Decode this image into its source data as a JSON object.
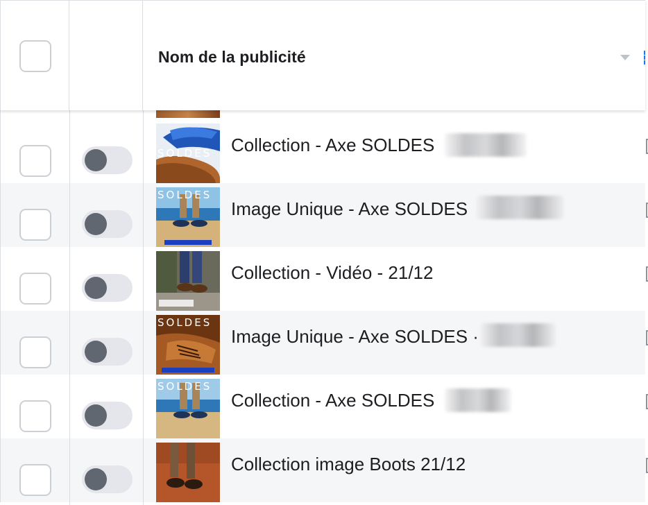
{
  "header": {
    "column_name": "Nom de la publicité"
  },
  "ads": [
    {
      "name": "Collection - Axe SOLDES",
      "thumb": "shoe-soldes-blue",
      "active": false,
      "blurred": true
    },
    {
      "name": "Image Unique - Axe SOLDES",
      "thumb": "beach-soldes",
      "active": false,
      "blurred": true
    },
    {
      "name": "Collection - Vidéo - 21/12",
      "thumb": "jeans-boots",
      "active": false,
      "blurred": false
    },
    {
      "name": "Image Unique - Axe SOLDES ·",
      "thumb": "leather-soldes",
      "active": false,
      "blurred": true
    },
    {
      "name": "Collection - Axe SOLDES",
      "thumb": "beach-soldes-2",
      "active": false,
      "blurred": true
    },
    {
      "name": "Collection image Boots 21/12",
      "thumb": "boots-clay",
      "active": false,
      "blurred": false
    }
  ],
  "thumb_text": {
    "soldes": "SOLDES"
  },
  "colors": {
    "border": "#dadde1",
    "row_alt": "#f5f6f7",
    "toggle_off_track": "#e4e6eb",
    "toggle_off_knob": "#606770",
    "accent": "#1877f2"
  }
}
